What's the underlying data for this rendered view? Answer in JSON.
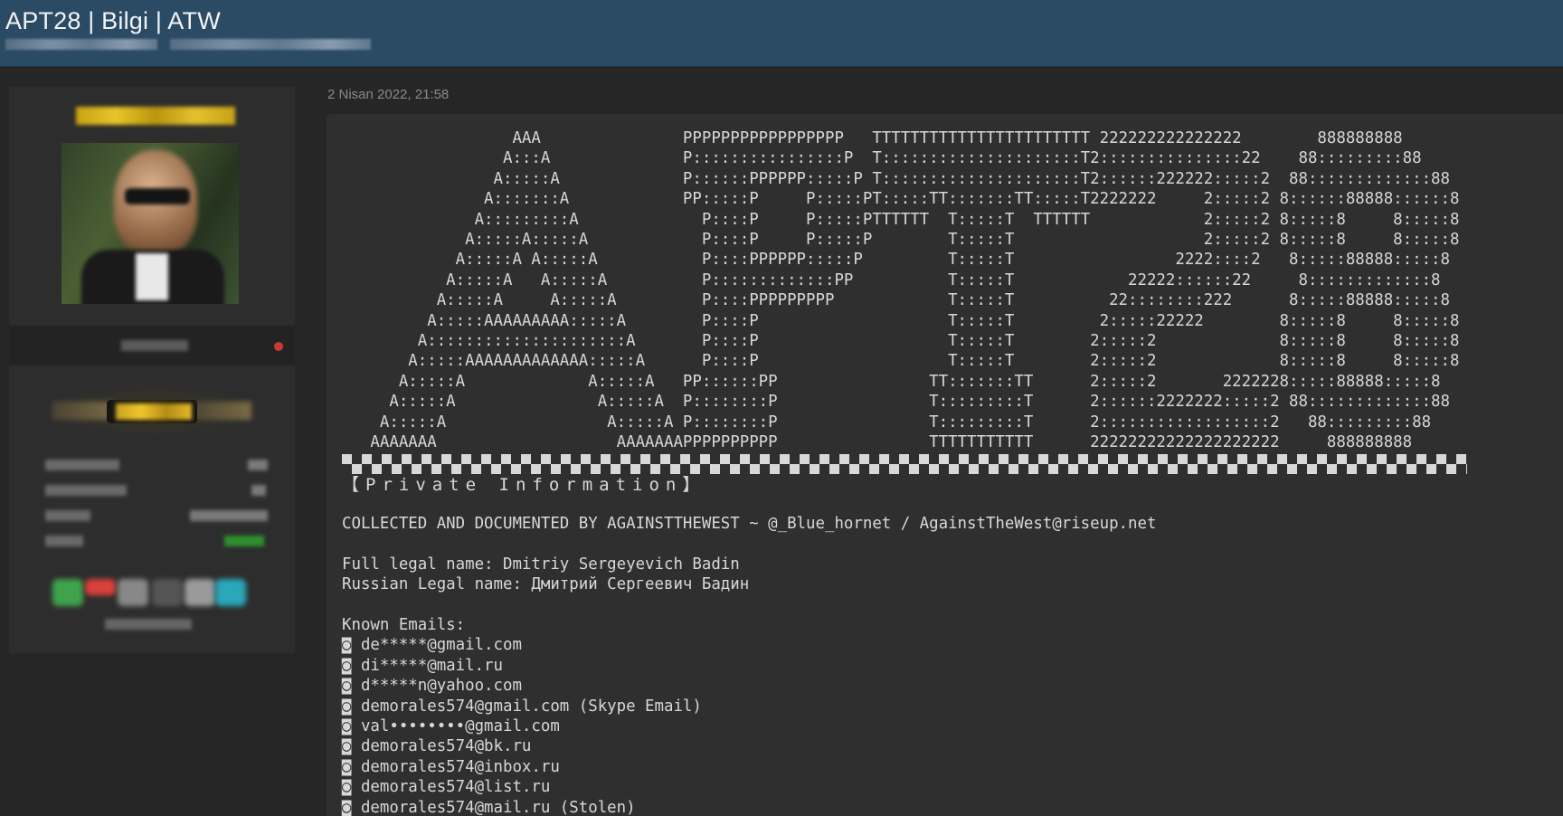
{
  "header": {
    "thread_title": "APT28 | Bilgi | ATW"
  },
  "post": {
    "date": "2 Nisan 2022, 21:58",
    "ascii_banner": "                  AAA               PPPPPPPPPPPPPPPPP   TTTTTTTTTTTTTTTTTTTTTTT 222222222222222        888888888\n                 A:::A              P::::::::::::::::P  T:::::::::::::::::::::T2:::::::::::::::22    88:::::::::88\n                A:::::A             P::::::PPPPPP:::::P T:::::::::::::::::::::T2::::::222222:::::2  88:::::::::::::88\n               A:::::::A            PP:::::P     P:::::PT:::::TT:::::::TT:::::T2222222     2:::::2 8::::::88888::::::8\n              A:::::::::A             P::::P     P:::::PTTTTTT  T:::::T  TTTTTT            2:::::2 8:::::8     8:::::8\n             A:::::A:::::A            P::::P     P:::::P        T:::::T                    2:::::2 8:::::8     8:::::8\n            A:::::A A:::::A           P::::PPPPPP:::::P         T:::::T                 2222::::2   8:::::88888:::::8\n           A:::::A   A:::::A          P:::::::::::::PP          T:::::T            22222::::::22     8:::::::::::::8\n          A:::::A     A:::::A         P::::PPPPPPPPP            T:::::T          22::::::::222      8:::::88888:::::8\n         A:::::AAAAAAAAA:::::A        P::::P                    T:::::T         2:::::22222        8:::::8     8:::::8\n        A:::::::::::::::::::::A       P::::P                    T:::::T        2:::::2             8:::::8     8:::::8\n       A:::::AAAAAAAAAAAAA:::::A      P::::P                    T:::::T        2:::::2             8:::::8     8:::::8\n      A:::::A             A:::::A   PP::::::PP                TT:::::::TT      2:::::2       2222228:::::88888:::::8\n     A:::::A               A:::::A  P::::::::P                T:::::::::T      2::::::2222222:::::2 88:::::::::::::88\n    A:::::A                 A:::::A P::::::::P                T:::::::::T      2::::::::::::::::::2   88:::::::::88\n   AAAAAAA                   AAAAAAAPPPPPPPPPP                TTTTTTTTTTT      22222222222222222222     888888888",
    "section_heading": "【Private Information】",
    "collected_by": "COLLECTED AND DOCUMENTED BY AGAINSTTHEWEST ~ @_Blue_hornet / AgainstTheWest@riseup.net",
    "full_legal_name": "Full legal name: Dmitriy Sergeyevich Badin",
    "russian_legal_name": "Russian Legal name: Дмитрий Сергеевич Бадин",
    "emails_heading": "Known Emails:",
    "emails": [
      "◙ de*****@gmail.com",
      "◙ di*****@mail.ru",
      "◙ d*****n@yahoo.com",
      "◙ demorales574@gmail.com (Skype Email)",
      "◙ val••••••••@gmail.com",
      "◙ demorales574@bk.ru",
      "◙ demorales574@inbox.ru",
      "◙ demorales574@list.ru",
      "◙ demorales574@mail.ru (Stolen)"
    ]
  },
  "colors": {
    "header_bg": "#2b4a63",
    "page_bg": "#262626",
    "post_bg": "#2f2f2f",
    "text": "#d8d8d8",
    "online_dot": "#c93a35"
  }
}
